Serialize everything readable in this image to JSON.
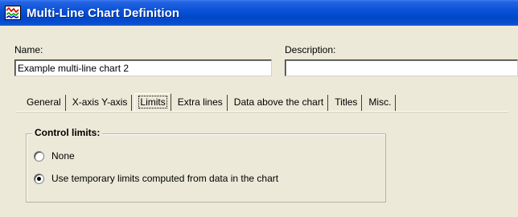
{
  "window": {
    "title": "Multi-Line Chart Definition"
  },
  "form": {
    "name_label": "Name:",
    "name_value": "Example multi-line chart 2",
    "description_label": "Description:",
    "description_value": ""
  },
  "tabs": [
    {
      "label": "General",
      "active": false
    },
    {
      "label": "X-axis Y-axis",
      "active": false
    },
    {
      "label": "Limits",
      "active": true
    },
    {
      "label": "Extra lines",
      "active": false
    },
    {
      "label": "Data above the chart",
      "active": false
    },
    {
      "label": "Titles",
      "active": false
    },
    {
      "label": "Misc.",
      "active": false
    }
  ],
  "control_limits": {
    "title": "Control limits:",
    "options": [
      {
        "label": "None",
        "checked": false
      },
      {
        "label": "Use temporary limits computed from data in the chart",
        "checked": true
      }
    ]
  },
  "colors": {
    "titlebar": "#0a52d8",
    "window_bg": "#ece9d8"
  }
}
